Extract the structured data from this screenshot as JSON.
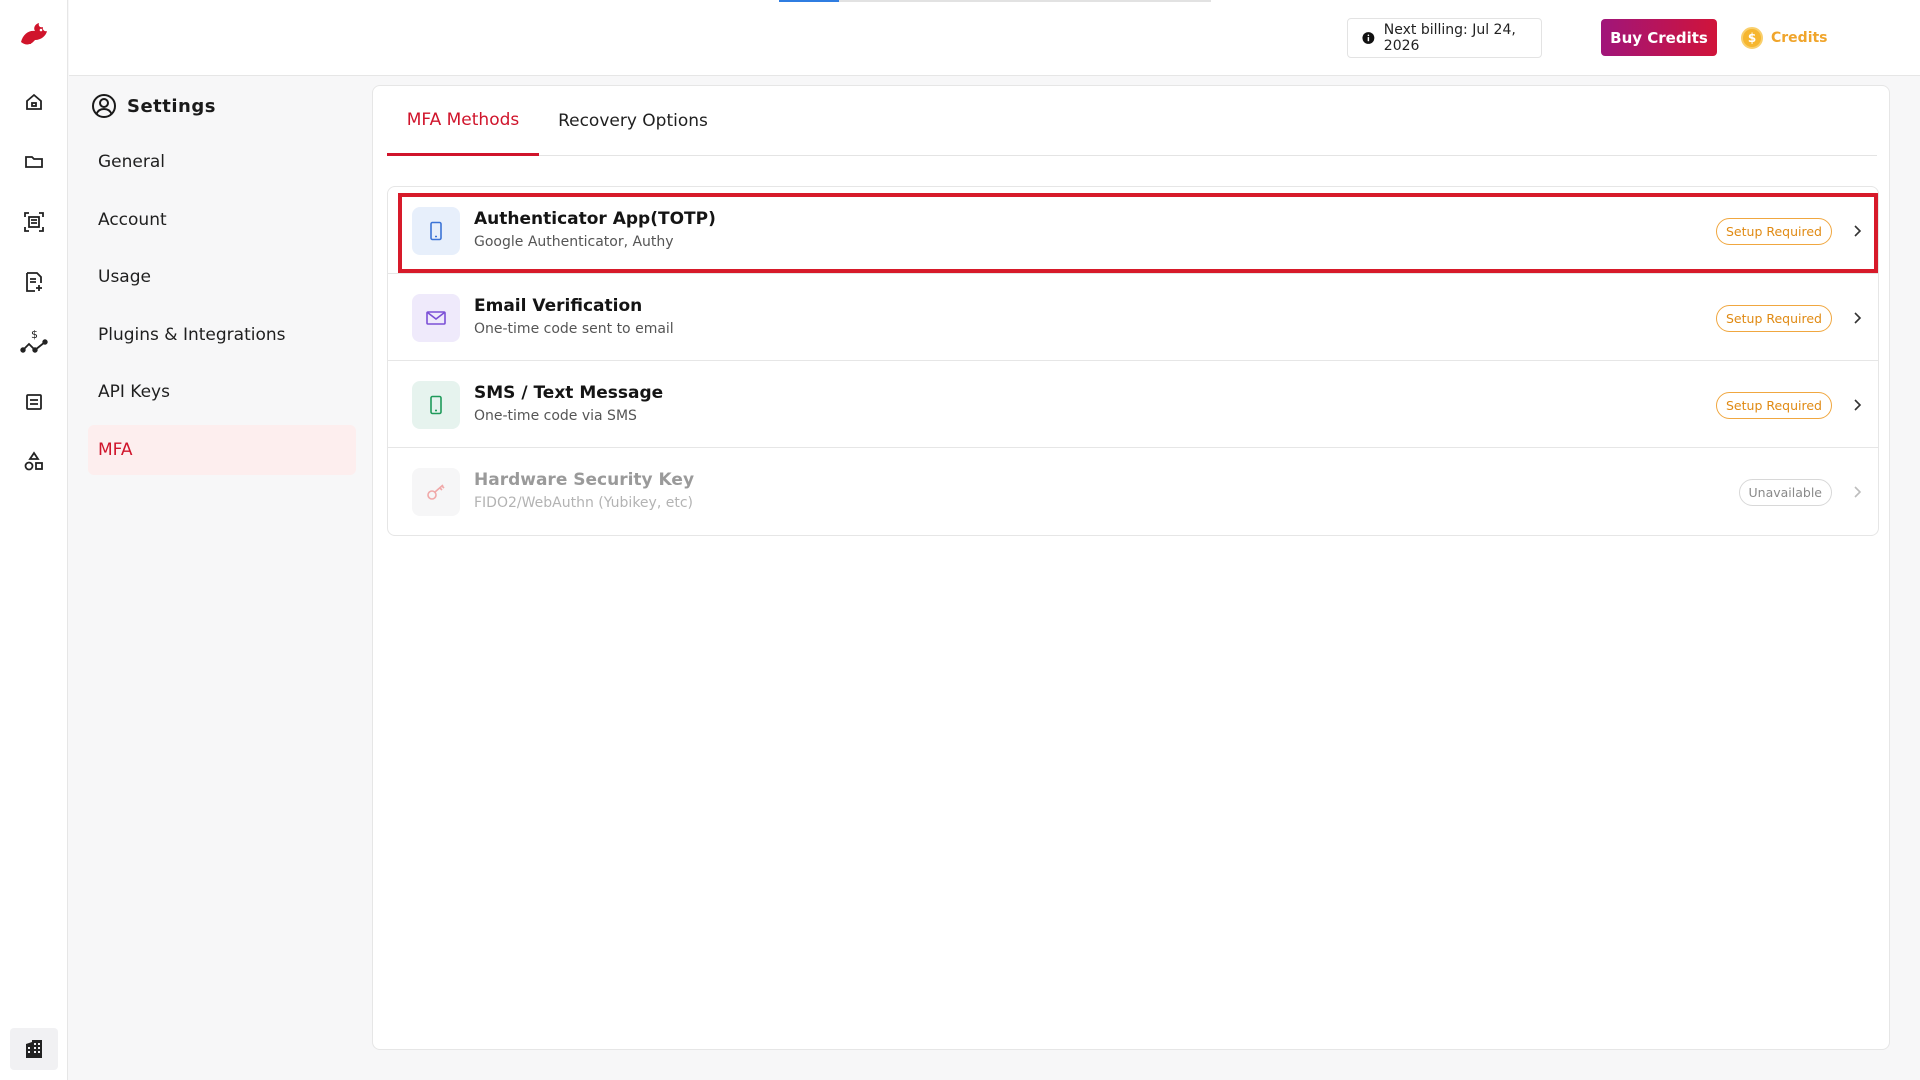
{
  "topbar": {
    "billing_text": "Next billing: Jul 24, 2026",
    "buy_credits_label": "Buy Credits",
    "credits_label": "Credits",
    "coin_symbol": "$",
    "progress_fraction": 0.14
  },
  "rail": {
    "icons": [
      "home-icon",
      "folder-icon",
      "scan-icon",
      "document-add-icon",
      "pricing-graph-icon",
      "list-icon",
      "shapes-icon"
    ],
    "bottom_icon": "building-icon"
  },
  "settings": {
    "title": "Settings",
    "items": [
      {
        "label": "General"
      },
      {
        "label": "Account"
      },
      {
        "label": "Usage"
      },
      {
        "label": "Plugins & Integrations"
      },
      {
        "label": "API Keys"
      },
      {
        "label": "MFA",
        "active": true
      }
    ]
  },
  "tabs": [
    {
      "label": "MFA Methods",
      "active": true
    },
    {
      "label": "Recovery Options",
      "active": false
    }
  ],
  "methods": [
    {
      "title": "Authenticator App(TOTP)",
      "subtitle": "Google Authenticator, Authy",
      "badge": "Setup Required",
      "icon": "phone-icon",
      "highlighted": true
    },
    {
      "title": "Email Verification",
      "subtitle": "One-time code sent to email",
      "badge": "Setup Required",
      "icon": "mail-icon"
    },
    {
      "title": "SMS / Text Message",
      "subtitle": "One-time code via SMS",
      "badge": "Setup Required",
      "icon": "sms-icon"
    },
    {
      "title": "Hardware Security Key",
      "subtitle": "FIDO2/WebAuthn (Yubikey, etc)",
      "badge": "Unavailable",
      "icon": "key-icon",
      "disabled": true
    }
  ],
  "colors": {
    "accent": "#d0142b",
    "warning": "#e08a13",
    "progress": "#2f7de1"
  }
}
